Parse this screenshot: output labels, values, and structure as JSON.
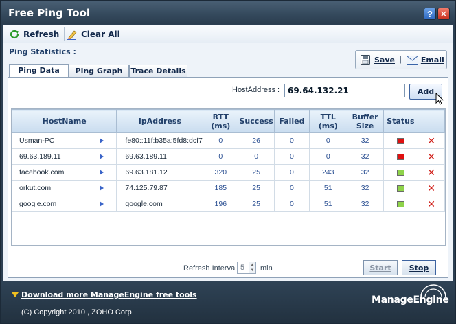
{
  "window": {
    "title": "Free Ping Tool",
    "help_glyph": "?",
    "close_glyph": "✕"
  },
  "toolbar": {
    "refresh_label": "Refresh",
    "clear_all_label": "Clear All"
  },
  "section": {
    "ping_statistics": "Ping Statistics :"
  },
  "actions": {
    "save_label": "Save",
    "separator": "|",
    "email_label": "Email"
  },
  "tabs": [
    {
      "label": "Ping Data",
      "active": true
    },
    {
      "label": "Ping Graph",
      "active": false
    },
    {
      "label": "Trace Details",
      "active": false
    }
  ],
  "host_address": {
    "label": "HostAddress :",
    "value": "69.64.132.21",
    "add_label": "Add"
  },
  "table": {
    "columns": [
      "HostName",
      "IpAddress",
      "RTT (ms)",
      "Success",
      "Failed",
      "TTL (ms)",
      "Buffer Size",
      "Status",
      ""
    ],
    "rows": [
      {
        "hostname": "Usman-PC",
        "ip": "fe80::11f:b35a:5fd8:dcf7",
        "rtt": "0",
        "success": "26",
        "failed": "0",
        "ttl": "0",
        "buffer": "32",
        "status": "red"
      },
      {
        "hostname": "69.63.189.11",
        "ip": "69.63.189.11",
        "rtt": "0",
        "success": "0",
        "failed": "0",
        "ttl": "0",
        "buffer": "32",
        "status": "red"
      },
      {
        "hostname": "facebook.com",
        "ip": "69.63.181.12",
        "rtt": "320",
        "success": "25",
        "failed": "0",
        "ttl": "243",
        "buffer": "32",
        "status": "green"
      },
      {
        "hostname": "orkut.com",
        "ip": "74.125.79.87",
        "rtt": "185",
        "success": "25",
        "failed": "0",
        "ttl": "51",
        "buffer": "32",
        "status": "green"
      },
      {
        "hostname": "google.com",
        "ip": "google.com",
        "rtt": "196",
        "success": "25",
        "failed": "0",
        "ttl": "51",
        "buffer": "32",
        "status": "green"
      }
    ],
    "delete_glyph": "✕"
  },
  "refresh": {
    "label": "Refresh Interval",
    "value": "5",
    "unit": "min"
  },
  "controls": {
    "start_label": "Start",
    "stop_label": "Stop"
  },
  "footer": {
    "download_link": "Download more ManageEngine free tools",
    "copyright": "(C) Copyright 2010 , ZOHO Corp",
    "brand": "ManageEngine"
  },
  "colors": {
    "status_red": "#e01010",
    "status_green": "#8fd34a",
    "delete_red": "#d0201a"
  }
}
